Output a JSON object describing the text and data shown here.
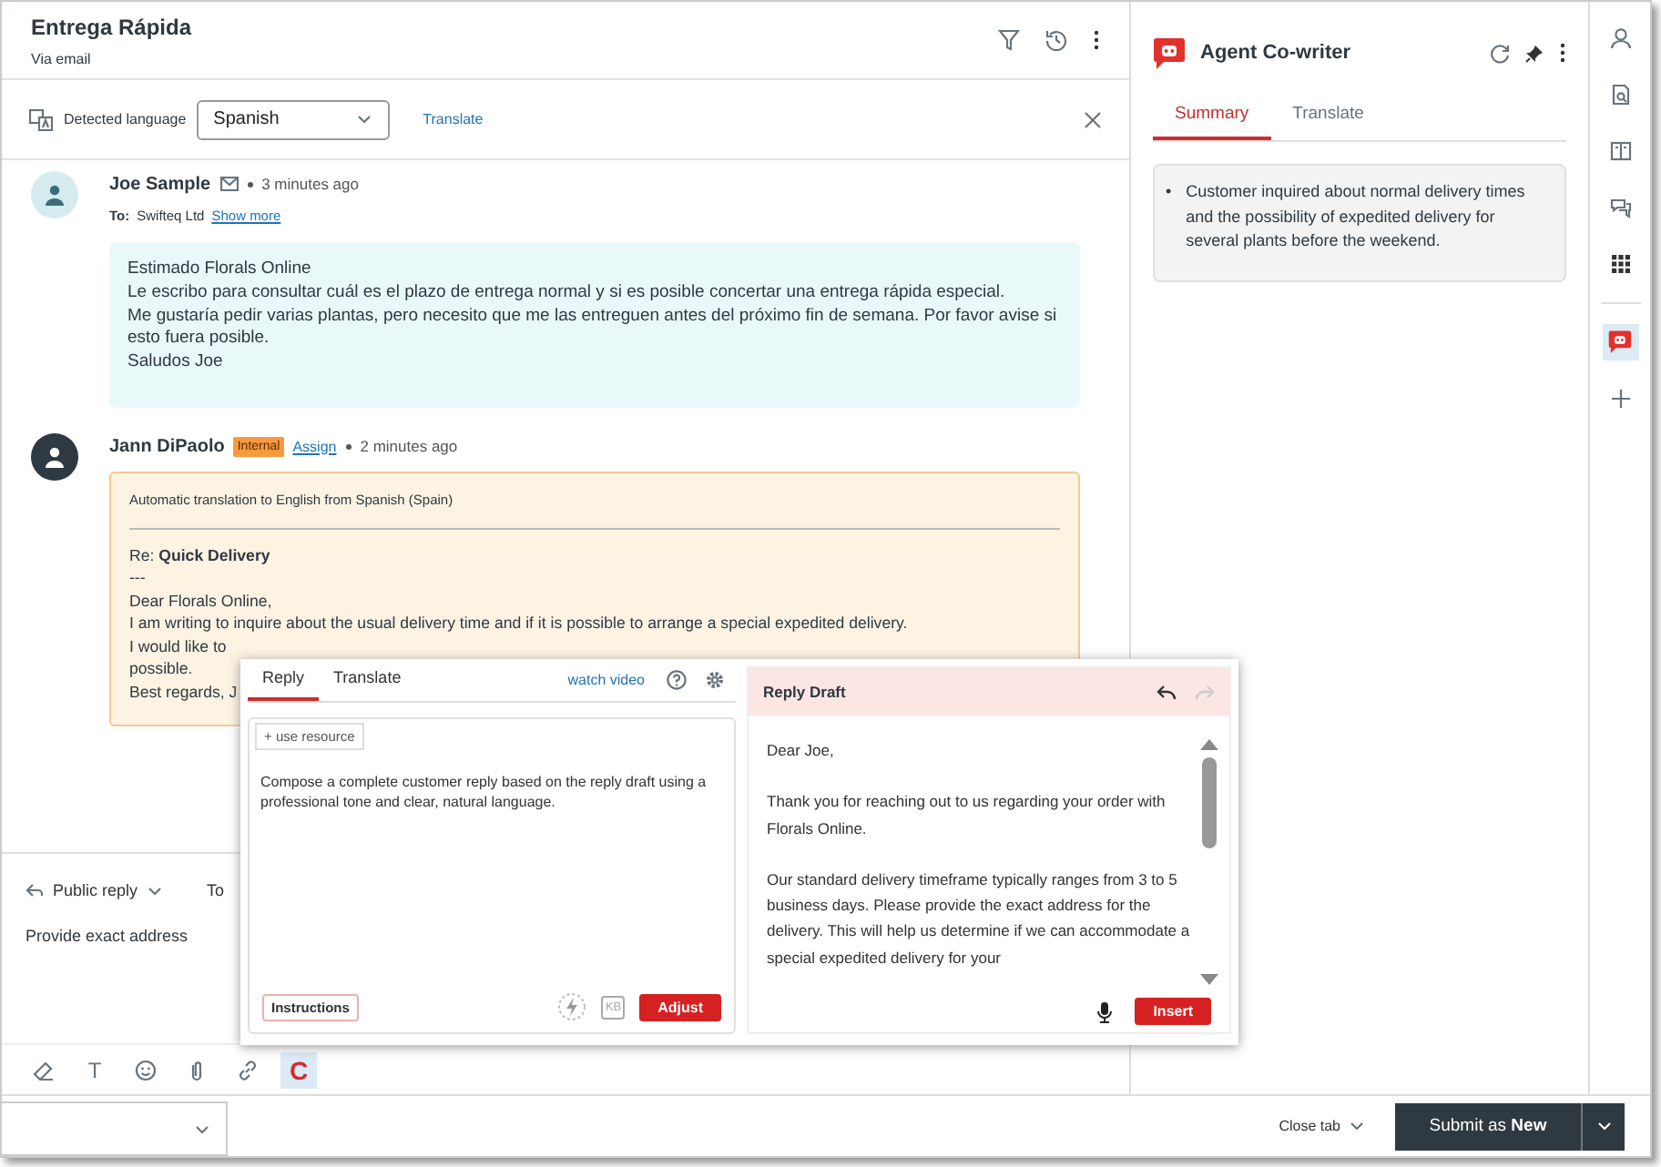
{
  "ticket": {
    "title": "Entrega Rápida",
    "channel": "Via email"
  },
  "language_bar": {
    "label": "Detected language",
    "language": "Spanish",
    "action": "Translate"
  },
  "messages": [
    {
      "kind": "customer",
      "author": "Joe Sample",
      "time": "3 minutes ago",
      "to_label": "To:",
      "to": "Swifteq Ltd",
      "show_more": "Show more",
      "body": [
        "Estimado Florals Online",
        "Le escribo para consultar cuál es el plazo de entrega normal y si es posible concertar una entrega rápida especial.",
        "Me gustaría pedir varias plantas, pero necesito que me las entreguen antes del próximo fin de semana. Por favor avise si esto fuera posible.",
        "Saludos Joe"
      ]
    },
    {
      "kind": "internal",
      "author": "Jann DiPaolo",
      "badge": "Internal",
      "assign": "Assign",
      "time": "2 minutes ago",
      "note": "Automatic translation to English from Spanish (Spain)",
      "body": [
        "Re: **Quick Delivery**",
        "---",
        "Dear Florals Online,",
        "I am writing to inquire about the usual delivery time and if it is possible to arrange a special expedited delivery.",
        "I would like to",
        "possible.",
        "Best regards, J"
      ]
    }
  ],
  "composer": {
    "mode": "Public reply",
    "to_label": "To",
    "text": "Provide exact address"
  },
  "toolbar": [
    {
      "kind": "eraser",
      "selected": false
    },
    {
      "kind": "text",
      "label": "T",
      "selected": false
    },
    {
      "kind": "emoji",
      "selected": false
    },
    {
      "kind": "attach",
      "selected": false
    },
    {
      "kind": "link",
      "selected": false
    },
    {
      "kind": "cowriter",
      "label": "C",
      "selected": true
    }
  ],
  "cowriter_popup": {
    "tabs": [
      {
        "label": "Reply",
        "selected": true
      },
      {
        "label": "Translate",
        "selected": false
      }
    ],
    "watch_video": "watch video",
    "resource_button": "+ use resource",
    "prompt": "Compose a complete customer reply based on the reply draft using a professional tone and clear, natural language.",
    "instructions": "Instructions",
    "kb": "KB",
    "adjust": "Adjust",
    "draft_title": "Reply Draft",
    "draft": [
      "Dear Joe,",
      "Thank you for reaching out to us regarding your order with Florals Online.",
      "Our standard delivery timeframe typically ranges from 3 to 5 business days. Please provide the exact address for the delivery. This will help us determine if we can accommodate a special expedited delivery for your"
    ],
    "insert": "Insert"
  },
  "side_panel": {
    "title": "Agent Co-writer",
    "tabs": [
      {
        "label": "Summary",
        "selected": true
      },
      {
        "label": "Translate",
        "selected": false
      }
    ],
    "summary": [
      {
        "marker": "•",
        "text": "Customer inquired about normal delivery times and the possibility of expedited delivery for several plants before the weekend."
      }
    ]
  },
  "rail": [
    {
      "kind": "person",
      "selected": false
    },
    {
      "kind": "document",
      "selected": false
    },
    {
      "kind": "book",
      "selected": false
    },
    {
      "kind": "chat",
      "selected": false
    },
    {
      "kind": "apps",
      "selected": false
    },
    {
      "kind": "cowriter",
      "selected": true
    },
    {
      "kind": "add",
      "selected": false
    }
  ],
  "footer": {
    "close_tab": "Close tab",
    "submit": "Submit as **New**"
  }
}
